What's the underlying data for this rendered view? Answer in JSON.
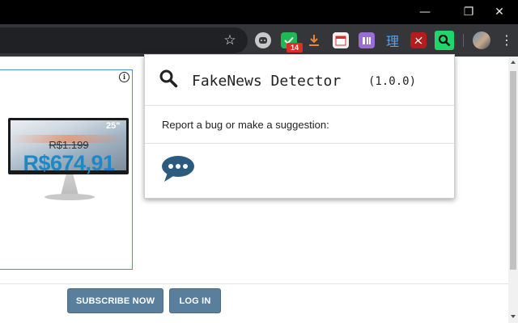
{
  "window": {
    "minimize_icon": "minimize-icon",
    "maximize_icon": "restore-icon",
    "close_icon": "close-icon",
    "minimize_glyph": "—",
    "maximize_glyph": "❐",
    "close_glyph": "✕"
  },
  "toolbar": {
    "star_icon": "bookmark-star-icon",
    "star_glyph": "☆",
    "extensions": [
      {
        "name": "discord-extension-icon"
      },
      {
        "name": "checkmark-extension-icon",
        "badge": "14"
      },
      {
        "name": "download-extension-icon"
      },
      {
        "name": "calendar-extension-icon"
      },
      {
        "name": "translate-extension-icon"
      },
      {
        "name": "dictionary-extension-icon",
        "glyph": "理"
      },
      {
        "name": "pdf-extension-icon"
      },
      {
        "name": "fakenews-detector-extension-icon"
      }
    ],
    "menu_glyph": "⋮"
  },
  "ad": {
    "info_glyph": "i",
    "monitor_size": "25\"",
    "old_price": "R$1.199",
    "new_price": "R$674,91"
  },
  "footer": {
    "subscribe_label": "SUBSCRIBE NOW",
    "login_label": "LOG IN"
  },
  "popup": {
    "title": "FakeNews Detector",
    "version": "(1.0.0)",
    "report_text": "Report a bug or make a suggestion:",
    "feedback_icon": "speech-bubble-icon"
  },
  "colors": {
    "titlebar": "#000000",
    "toolbar": "#35363a",
    "omnibox": "#202124",
    "cta_button": "#5a7f9c",
    "price_blue": "#1e88c7",
    "feedback_icon": "#2c5b80",
    "extension_active": "#1fd66a"
  }
}
